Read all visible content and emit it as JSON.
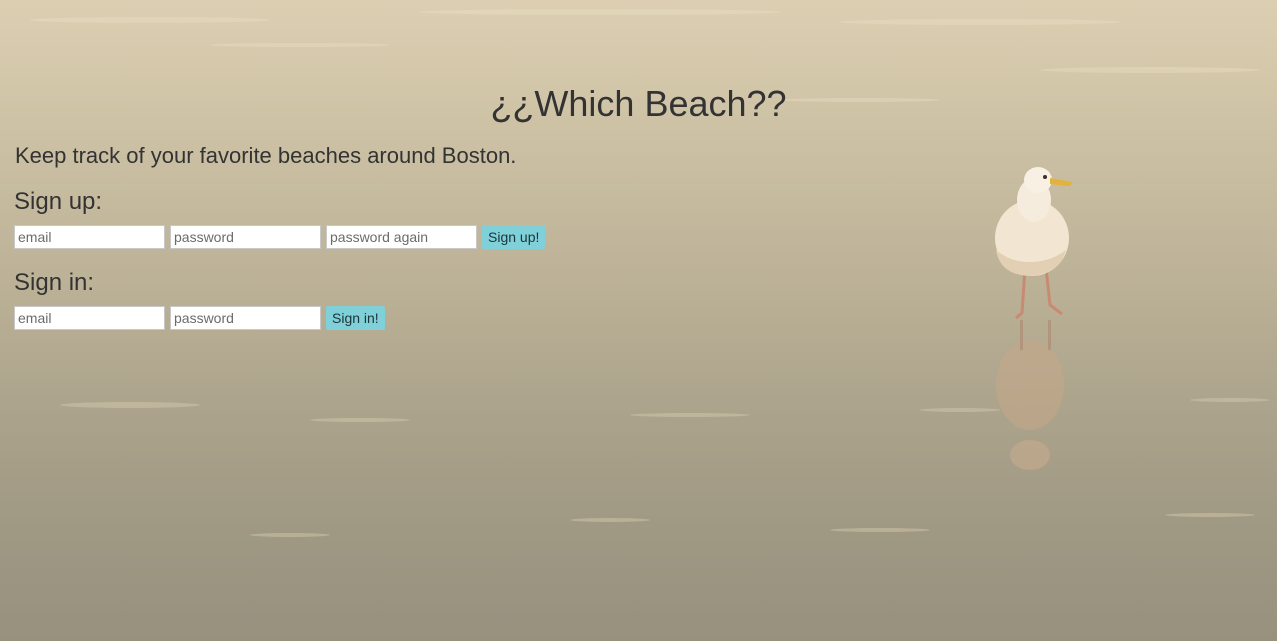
{
  "page": {
    "title": "¿¿Which Beach??",
    "subtitle": "Keep track of your favorite beaches around Boston."
  },
  "signup": {
    "heading": "Sign up:",
    "email_placeholder": "email",
    "password_placeholder": "password",
    "password_again_placeholder": "password again",
    "button_label": "Sign up!"
  },
  "signin": {
    "heading": "Sign in:",
    "email_placeholder": "email",
    "password_placeholder": "password",
    "button_label": "Sign in!"
  },
  "colors": {
    "button": "#7fd0d9",
    "text": "#333333"
  },
  "background": {
    "icon": "seagull-on-beach-photo"
  }
}
